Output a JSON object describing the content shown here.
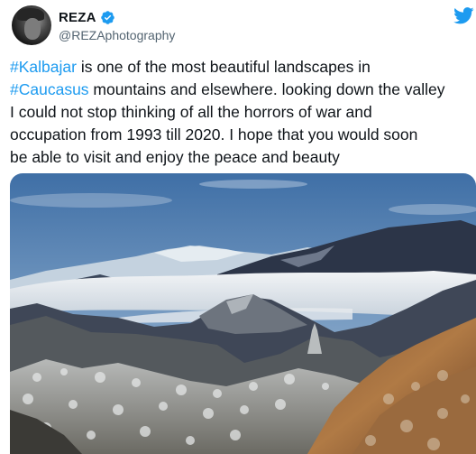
{
  "author": {
    "name": "REZA",
    "handle": "@REZAphotography",
    "verified": true
  },
  "tweet": {
    "segments": [
      {
        "type": "hashtag",
        "text": "#Kalbajar"
      },
      {
        "type": "text",
        "text": " is one of the most beautiful landscapes in\n"
      },
      {
        "type": "hashtag",
        "text": "#Caucasus"
      },
      {
        "type": "text",
        "text": " mountains and elsewhere. looking down the valley\nI could not stop thinking of all the horrors of war and\noccupation from 1993 till 2020. I hope that you would soon\nbe able to visit and enjoy the peace and beauty"
      }
    ]
  },
  "icons": {
    "verified": "verified-badge-icon",
    "logo": "twitter-bird-icon"
  },
  "colors": {
    "accent": "#1d9bf0",
    "text": "#0f1419",
    "secondary_text": "#536471"
  }
}
